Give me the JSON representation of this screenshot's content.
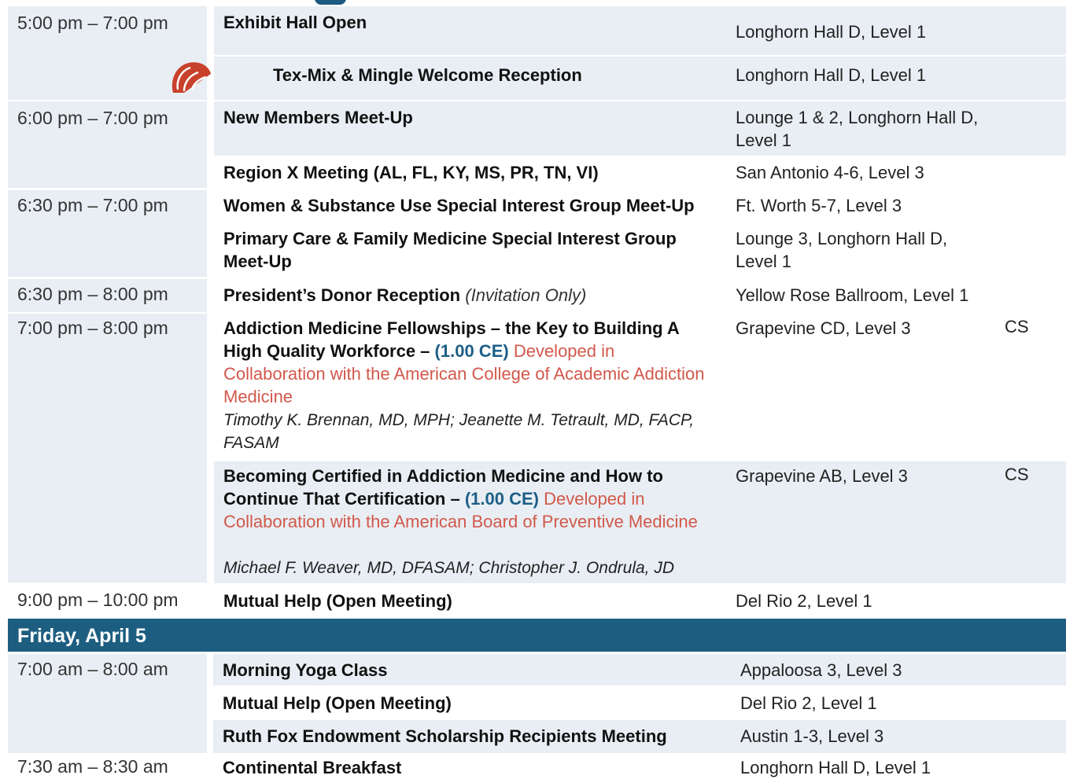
{
  "thursday": {
    "rows": [
      {
        "time": "5:00 pm – 7:00 pm",
        "title": "Exhibit Hall Open",
        "location": "Longhorn Hall D, Level 1"
      },
      {
        "time": "",
        "title": "Tex-Mix & Mingle Welcome Reception",
        "location": "Longhorn Hall D, Level 1",
        "icon": "taco-icon"
      },
      {
        "time": "6:00 pm – 7:00 pm",
        "title": "New Members Meet-Up",
        "location": "Lounge 1 & 2, Longhorn Hall D, Level 1"
      },
      {
        "time": "",
        "title": "Region X Meeting (AL, FL, KY, MS, PR, TN, VI)",
        "location": "San Antonio 4-6, Level 3"
      },
      {
        "time": "6:30 pm – 7:00 pm",
        "title": "Women & Substance Use Special Interest Group Meet-Up",
        "location": "Ft. Worth 5-7, Level 3"
      },
      {
        "time": "",
        "title": "Primary Care & Family Medicine Special Interest Group Meet-Up",
        "location": "Lounge 3, Longhorn Hall D, Level 1"
      },
      {
        "time": "6:30 pm – 8:00 pm",
        "title": "President’s Donor Reception",
        "note": "(Invitation Only)",
        "location": "Yellow Rose Ballroom, Level 1"
      },
      {
        "time": "7:00 pm – 8:00 pm",
        "title": "Addiction Medicine Fellowships – the Key to Building A High Quality Workforce –",
        "ce": "(1.00 CE)",
        "collab": "Developed in Collaboration with the American College of Academic Addiction Medicine",
        "speakers": "Timothy K. Brennan, MD, MPH; Jeanette M. Tetrault, MD, FACP, FASAM",
        "location": "Grapevine CD, Level 3",
        "code": "CS"
      },
      {
        "time": "",
        "title": "Becoming Certified in Addiction Medicine and How to Continue That Certification –",
        "ce": "(1.00 CE)",
        "collab": "Developed in Collaboration with the American Board of Preventive Medicine",
        "speakers": "Michael F. Weaver, MD, DFASAM; Christopher J. Ondrula, JD",
        "location": "Grapevine AB, Level 3",
        "code": "CS"
      },
      {
        "time": "9:00 pm – 10:00 pm",
        "title": "Mutual Help (Open Meeting)",
        "location": "Del Rio 2, Level 1"
      }
    ]
  },
  "friday": {
    "header": "Friday, April 5",
    "rows": [
      {
        "time": "7:00 am – 8:00 am",
        "title": "Morning Yoga Class",
        "location": "Appaloosa 3, Level 3"
      },
      {
        "time": "",
        "title": "Mutual Help (Open Meeting)",
        "location": "Del Rio 2, Level 1"
      },
      {
        "time": "",
        "title": "Ruth Fox Endowment Scholarship Recipients Meeting",
        "location": "Austin 1-3, Level 3"
      },
      {
        "time": "7:30 am – 8:30 am",
        "title": "Continental Breakfast",
        "location": "Longhorn Hall D, Level 1"
      }
    ]
  },
  "colors": {
    "band": "#e8eef3",
    "header": "#1d5e80",
    "ce": "#1d5e86",
    "collab": "#d2584b",
    "taco": "#c8412c"
  }
}
